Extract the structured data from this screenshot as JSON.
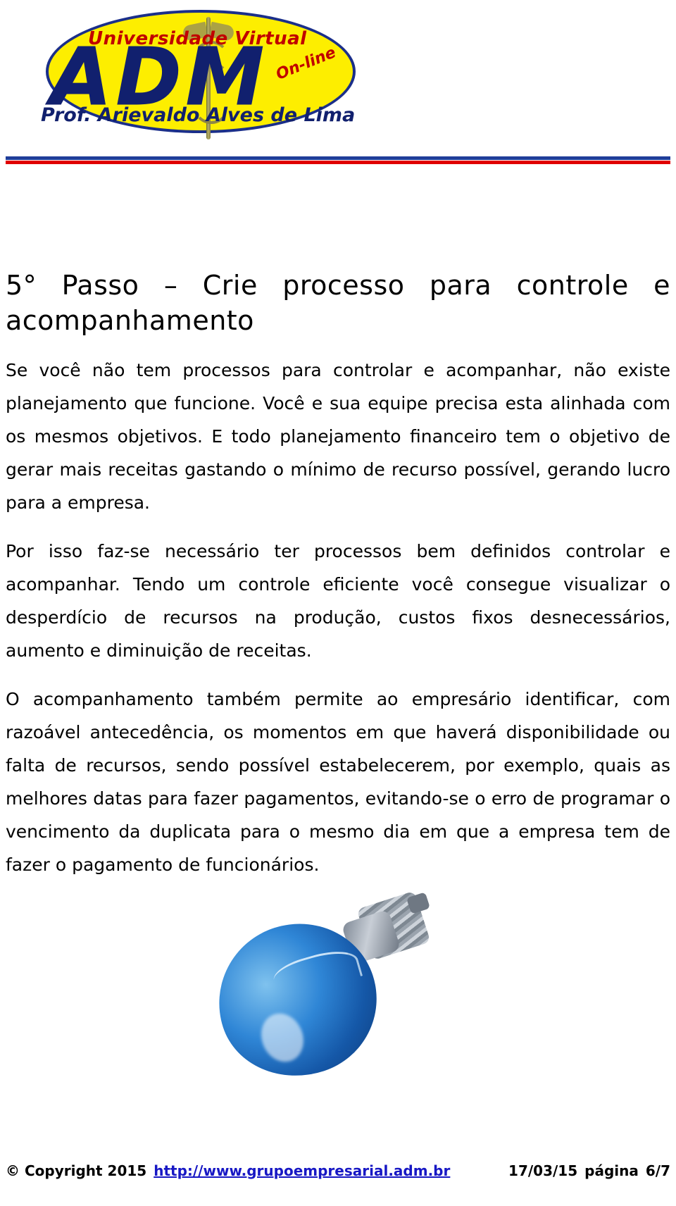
{
  "logo": {
    "university": "Universidade Virtual",
    "acronym": "ADM",
    "online_badge": "On-line",
    "professor": "Prof. Arievaldo Alves de Lima",
    "ellipse_color": "#fdee00",
    "border_color": "#1b2f8a",
    "red_color": "#c00000",
    "blue_color": "#11206e"
  },
  "divider": {
    "blue": "#1f3d99",
    "red": "#e00000"
  },
  "document": {
    "title_line1": "5° Passo – Crie processo para controle e",
    "title_line2": "acompanhamento",
    "paragraphs": [
      "Se você não tem processos para controlar e acompanhar, não existe planejamento que funcione. Você e sua equipe precisa esta alinhada com os mesmos objetivos. E todo planejamento financeiro tem o objetivo de gerar mais receitas gastando o mínimo de recurso possível, gerando lucro para a empresa.",
      "Por isso faz-se necessário ter processos bem definidos controlar e acompanhar. Tendo um controle eficiente você consegue visualizar o desperdício de recursos na produção, custos fixos desnecessários, aumento e diminuição de receitas.",
      "O acompanhamento também permite ao empresário identificar, com razoável antecedência, os momentos em que haverá disponibilidade ou falta de recursos, sendo possível estabelecerem, por exemplo, quais as melhores datas para fazer pagamentos, evitando-se o erro de programar o vencimento da duplicata para o mesmo dia em que a empresa tem de fazer o pagamento de funcionários."
    ]
  },
  "illustration": {
    "name": "blue-light-bulb"
  },
  "footer": {
    "copyright": "© Copyright 2015",
    "url": "http://www.grupoempresarial.adm.br",
    "date": "17/03/15",
    "page_label": "página",
    "page_number": "6/7",
    "link_color": "#1717c4"
  }
}
